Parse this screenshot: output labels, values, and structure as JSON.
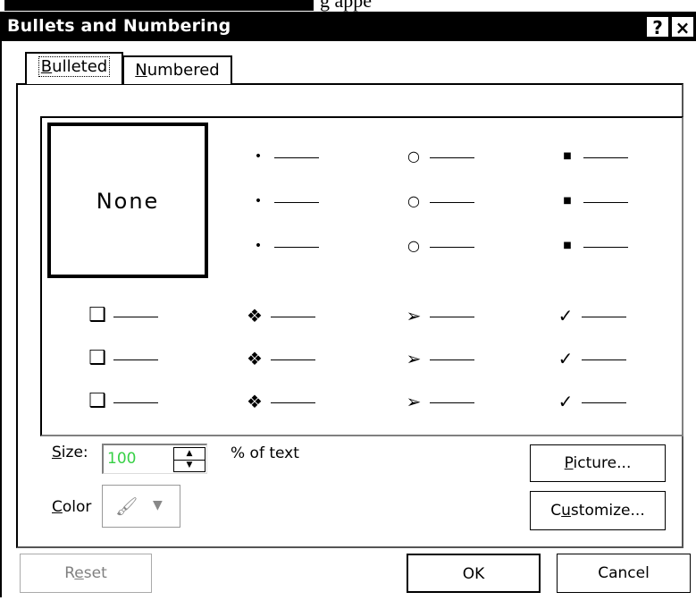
{
  "page_fragment": "g          appe",
  "dialog": {
    "title": "Bullets and Numbering",
    "help_label": "?",
    "close_label": "×"
  },
  "tabs": [
    {
      "mnemonic": "B",
      "rest": "ulleted",
      "selected": true
    },
    {
      "mnemonic": "N",
      "rest": "umbered",
      "selected": false
    }
  ],
  "gallery": {
    "selected": "None",
    "none_label": "None",
    "styles": [
      {
        "name": "dot-bullet",
        "symbol": "•"
      },
      {
        "name": "circle-bullet",
        "symbol": "○"
      },
      {
        "name": "square-bullet",
        "symbol": "■"
      },
      {
        "name": "checkbox-bullet",
        "symbol": "❑"
      },
      {
        "name": "diamond-dots-bullet",
        "symbol": "❖"
      },
      {
        "name": "arrow-bullet",
        "symbol": "➢"
      },
      {
        "name": "checkmark-bullet",
        "symbol": "✓"
      }
    ]
  },
  "size": {
    "label_mnemonic": "S",
    "label_rest": "ize:",
    "value": "100",
    "unit": "% of text",
    "value_color": "#37d046"
  },
  "color": {
    "label_mnemonic": "C",
    "label_rest": "olor",
    "icon": "paint-bucket-icon",
    "caret_icon": "chevron-down-icon"
  },
  "buttons": {
    "picture": {
      "mnemonic": "P",
      "rest": "icture..."
    },
    "customize": {
      "pre": "C",
      "mnemonic": "u",
      "rest": "stomize..."
    },
    "reset": {
      "pre": "R",
      "mnemonic": "e",
      "rest": "set"
    },
    "ok": "OK",
    "cancel": "Cancel"
  }
}
